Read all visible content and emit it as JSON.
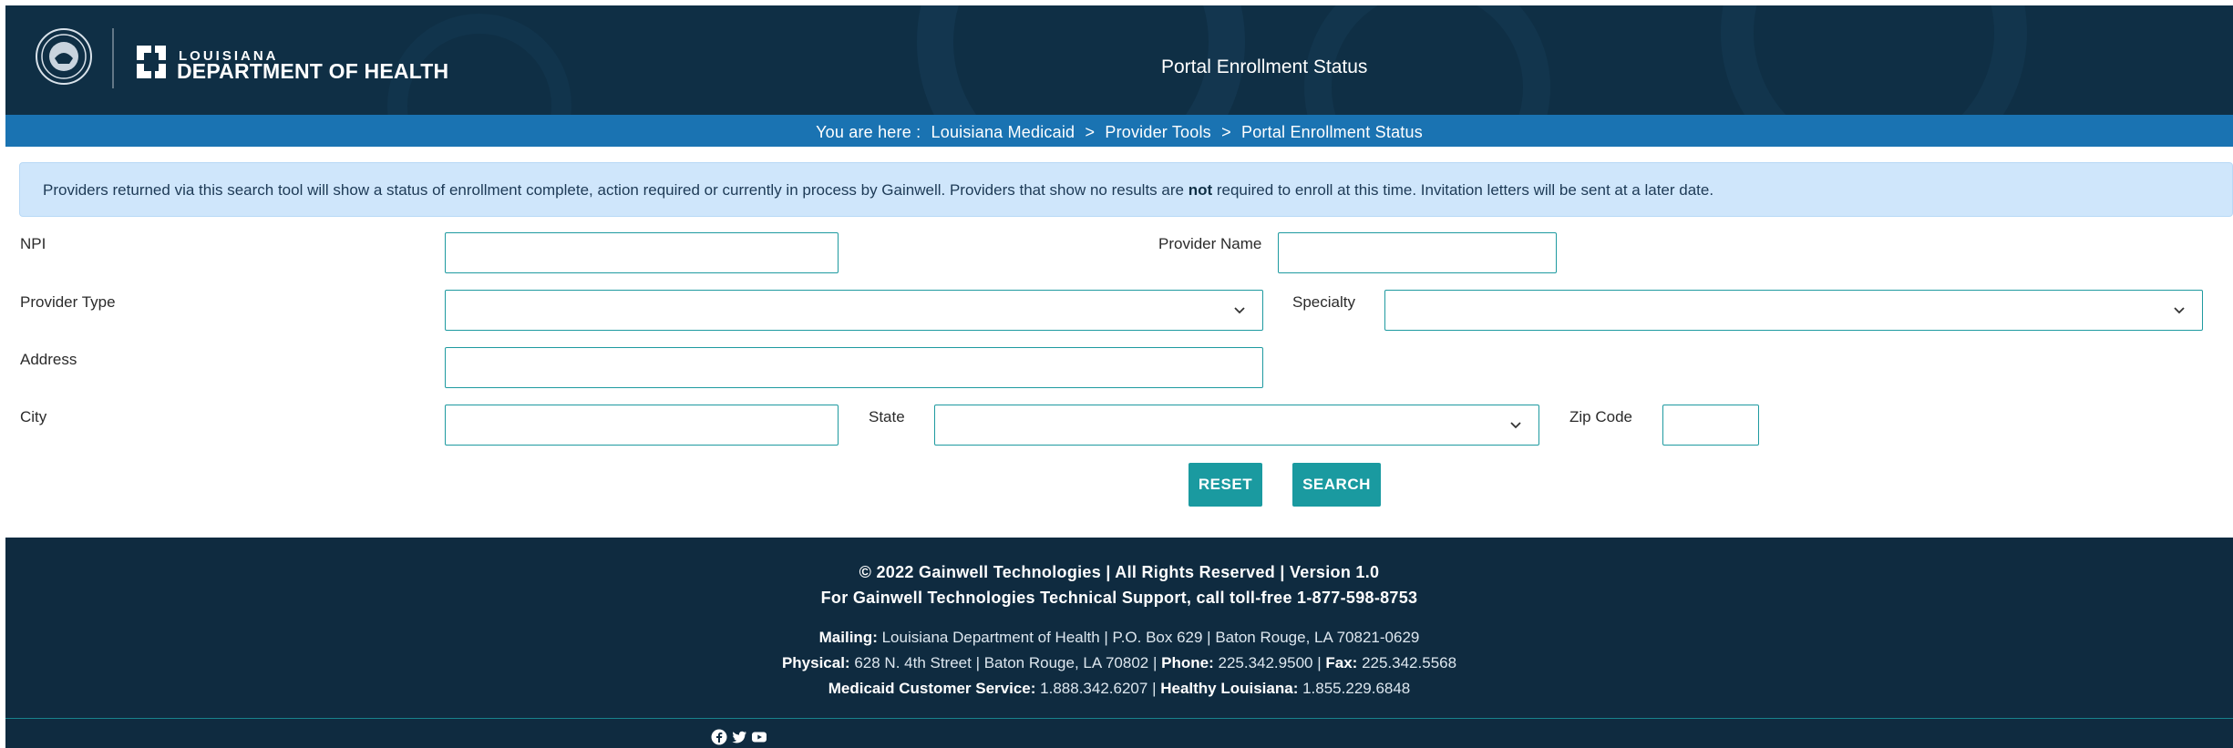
{
  "header": {
    "logo_small": "LOUISIANA",
    "logo_big": "DEPARTMENT OF HEALTH",
    "title": "Portal Enrollment Status"
  },
  "breadcrumb": {
    "prefix": "You are here :",
    "items": [
      "Louisiana Medicaid",
      "Provider Tools",
      "Portal Enrollment Status"
    ],
    "separator": ">"
  },
  "alert": {
    "text_before": "Providers returned via this search tool will show a status of enrollment complete, action required or currently in process by Gainwell. Providers that show no results are ",
    "text_bold": "not",
    "text_after": " required to enroll at this time. Invitation letters will be sent at a later date."
  },
  "form": {
    "npi_label": "NPI",
    "npi_value": "",
    "provider_name_label": "Provider Name",
    "provider_name_value": "",
    "provider_type_label": "Provider Type",
    "provider_type_value": "",
    "specialty_label": "Specialty",
    "specialty_value": "",
    "address_label": "Address",
    "address_value": "",
    "city_label": "City",
    "city_value": "",
    "state_label": "State",
    "state_value": "",
    "zip_label": "Zip Code",
    "zip_value": "",
    "reset_label": "RESET",
    "search_label": "SEARCH"
  },
  "footer": {
    "copyright": "© 2022 Gainwell Technologies | All Rights Reserved | Version 1.0",
    "support": "For Gainwell Technologies Technical Support, call toll-free 1-877-598-8753",
    "mailing_label": "Mailing:",
    "mailing_value": "Louisiana Department of Health | P.O. Box 629 | Baton Rouge, LA 70821-0629",
    "physical_label": "Physical:",
    "physical_value": "628 N. 4th Street | Baton Rouge, LA 70802 |",
    "phone_label": "Phone:",
    "phone_value": "225.342.9500 |",
    "fax_label": "Fax:",
    "fax_value": "225.342.5568",
    "mcs_label": "Medicaid Customer Service:",
    "mcs_value": "1.888.342.6207 |",
    "healthy_label": "Healthy Louisiana:",
    "healthy_value": "1.855.229.6848",
    "social_icons": [
      "facebook-icon",
      "twitter-icon",
      "youtube-icon"
    ]
  },
  "colors": {
    "header_bg": "#0f2f45",
    "crumb_bg": "#1a73b2",
    "alert_bg": "#cfe6fb",
    "accent": "#1a9aa0",
    "footer_bg": "#0f2b40"
  }
}
